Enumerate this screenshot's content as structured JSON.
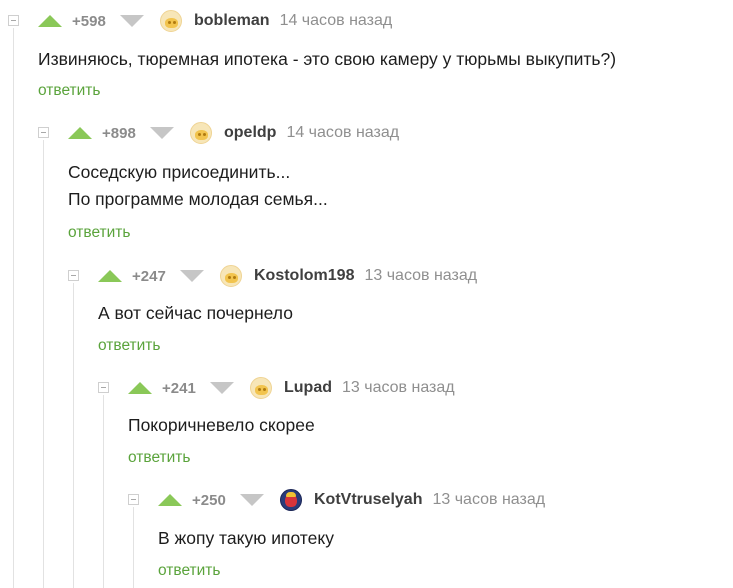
{
  "comments": [
    {
      "rating": "+598",
      "username": "bobleman",
      "time": "14 часов назад",
      "lines": [
        "Извиняюсь, тюремная ипотека - это свою камеру у тюрьмы выкупить?)"
      ],
      "reply": "ответить"
    },
    {
      "rating": "+898",
      "username": "opeldp",
      "time": "14 часов назад",
      "lines": [
        "Соседскую присоединить...",
        "По программе молодая семья..."
      ],
      "reply": "ответить"
    },
    {
      "rating": "+247",
      "username": "Kostolom198",
      "time": "13 часов назад",
      "lines": [
        "А вот сейчас почернело"
      ],
      "reply": "ответить"
    },
    {
      "rating": "+241",
      "username": "Lupad",
      "time": "13 часов назад",
      "lines": [
        "Покоричневело скорее"
      ],
      "reply": "ответить"
    },
    {
      "rating": "+250",
      "username": "KotVtruselyah",
      "time": "13 часов назад",
      "lines": [
        "В жопу такую ипотеку"
      ],
      "reply": "ответить"
    }
  ],
  "colors": {
    "upvote": "#8ac858",
    "downvote": "#c6c6c6",
    "reply_link": "#5aa33b",
    "thread_line": "#e2e2e2"
  },
  "icons": {
    "upvote": "triangle-up-icon",
    "downvote": "triangle-down-icon",
    "collapse": "minus-box-icon"
  }
}
